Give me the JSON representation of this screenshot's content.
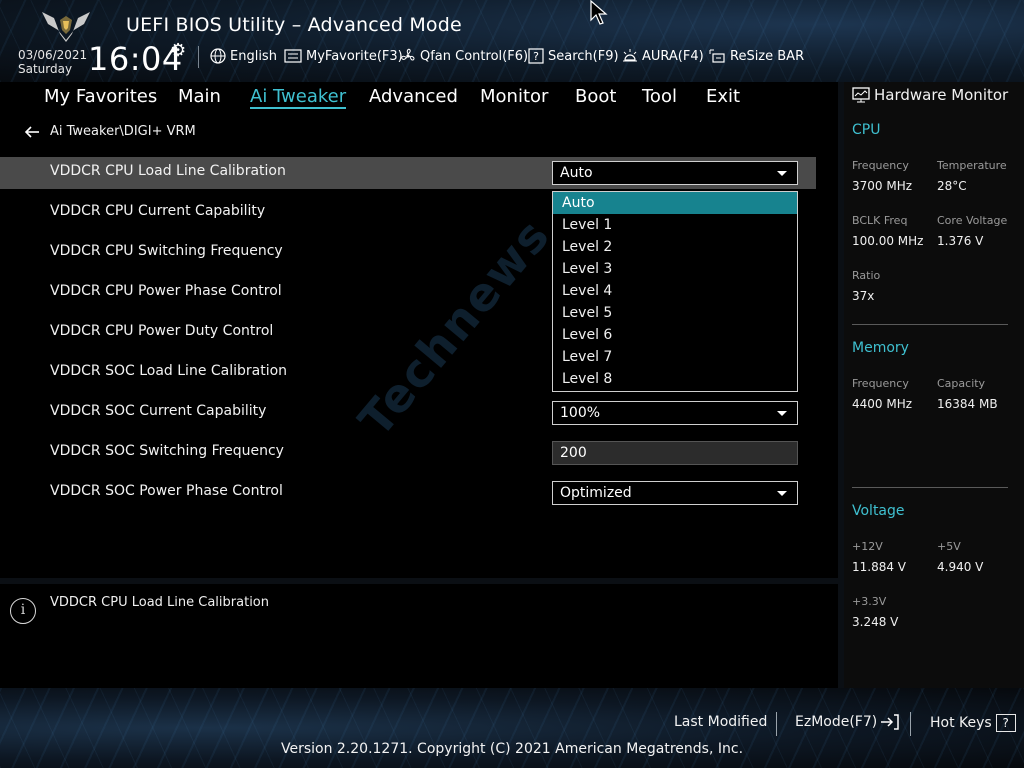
{
  "header": {
    "title": "UEFI BIOS Utility – Advanced Mode",
    "date": "03/06/2021",
    "day": "Saturday",
    "time": "16:04",
    "toolbar": {
      "language": "English",
      "favorite": "MyFavorite(F3)",
      "qfan": "Qfan Control(F6)",
      "search": "Search(F9)",
      "aura": "AURA(F4)",
      "resize_bar": "ReSize BAR"
    }
  },
  "menu": {
    "items": [
      "My Favorites",
      "Main",
      "Ai Tweaker",
      "Advanced",
      "Monitor",
      "Boot",
      "Tool",
      "Exit"
    ],
    "active": "Ai Tweaker"
  },
  "main": {
    "breadcrumb": "Ai Tweaker\\DIGI+ VRM",
    "settings": [
      {
        "label": "VDDCR CPU Load Line Calibration",
        "value": "Auto"
      },
      {
        "label": "VDDCR CPU Current Capability"
      },
      {
        "label": "VDDCR CPU Switching Frequency"
      },
      {
        "label": "VDDCR CPU Power Phase Control"
      },
      {
        "label": "VDDCR CPU Power Duty Control"
      },
      {
        "label": "VDDCR SOC Load Line Calibration"
      },
      {
        "label": "VDDCR SOC Current Capability",
        "value": "100%"
      },
      {
        "label": "VDDCR SOC Switching Frequency",
        "value": "200"
      },
      {
        "label": "VDDCR SOC Power Phase Control",
        "value": "Optimized"
      }
    ],
    "dropdown_options": [
      "Auto",
      "Level 1",
      "Level 2",
      "Level 3",
      "Level 4",
      "Level 5",
      "Level 6",
      "Level 7",
      "Level 8"
    ],
    "dropdown_selected": "Auto",
    "watermark": "Technews"
  },
  "help": {
    "text": "VDDCR CPU Load Line Calibration"
  },
  "hardware_monitor": {
    "title": "Hardware Monitor",
    "cpu": {
      "heading": "CPU",
      "frequency_label": "Frequency",
      "frequency": "3700 MHz",
      "temperature_label": "Temperature",
      "temperature": "28°C",
      "bclk_label": "BCLK Freq",
      "bclk": "100.00 MHz",
      "core_voltage_label": "Core Voltage",
      "core_voltage": "1.376 V",
      "ratio_label": "Ratio",
      "ratio": "37x"
    },
    "memory": {
      "heading": "Memory",
      "frequency_label": "Frequency",
      "frequency": "4400 MHz",
      "capacity_label": "Capacity",
      "capacity": "16384 MB"
    },
    "voltage": {
      "heading": "Voltage",
      "v12_label": "+12V",
      "v12": "11.884 V",
      "v5_label": "+5V",
      "v5": "4.940 V",
      "v33_label": "+3.3V",
      "v33": "3.248 V"
    }
  },
  "footer": {
    "last_modified": "Last Modified",
    "ezmode": "EzMode(F7)",
    "hotkeys": "Hot Keys",
    "hotkeys_key": "?",
    "copyright": "Version 2.20.1271. Copyright (C) 2021 American Megatrends, Inc."
  },
  "colors": {
    "accent": "#3fc0d0",
    "highlight": "#17838f",
    "selected_row": "#4a4a4a"
  }
}
